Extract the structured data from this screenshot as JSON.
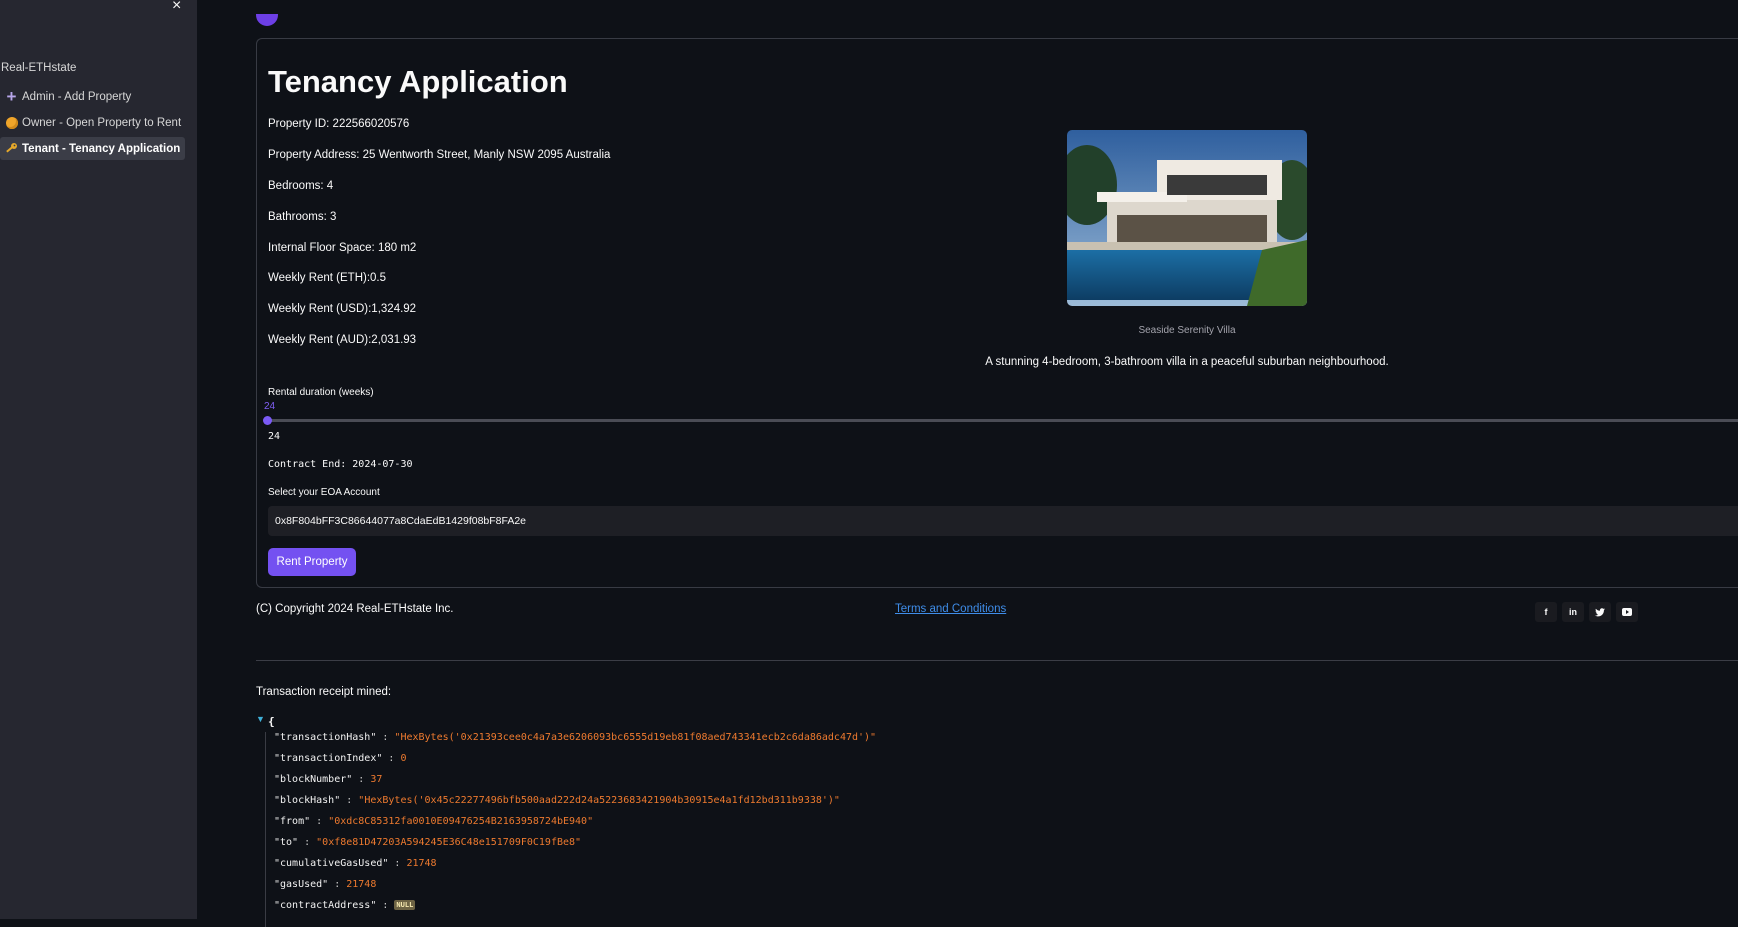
{
  "sidebar": {
    "app_name": "Real-ETHstate",
    "items": [
      {
        "label": "Admin - Add Property",
        "icon": "plus-icon"
      },
      {
        "label": "Owner - Open Property to Rent",
        "icon": "coin-icon"
      },
      {
        "label": "Tenant - Tenancy Application",
        "icon": "key-icon",
        "active": true
      }
    ]
  },
  "page": {
    "title": "Tenancy Application",
    "property": {
      "id": "Property ID: 222566020576",
      "address": "Property Address: 25 Wentworth Street, Manly NSW 2095 Australia",
      "bedrooms": "Bedrooms: 4",
      "bathrooms": "Bathrooms: 3",
      "floor_space": "Internal Floor Space: 180 m2",
      "rent_eth": "Weekly Rent (ETH):0.5",
      "rent_usd": "Weekly Rent (USD):1,324.92",
      "rent_aud": "Weekly Rent (AUD):2,031.93"
    },
    "image": {
      "caption": "Seaside Serenity Villa",
      "description": "A stunning 4-bedroom, 3-bathroom villa in a peaceful suburban neighbourhood."
    },
    "slider": {
      "label": "Rental duration (weeks)",
      "value_label": "24",
      "value": 24,
      "echo": "24"
    },
    "contract_end": "Contract End: 2024-07-30",
    "account": {
      "label": "Select your EOA Account",
      "selected": "0x8F804bFF3C86644077a8CdaEdB1429f08bF8FA2e"
    },
    "rent_button": "Rent Property"
  },
  "footer": {
    "copyright": "(C) Copyright 2024 Real-ETHstate Inc.",
    "terms": "Terms and Conditions",
    "social": [
      "facebook-icon",
      "linkedin-icon",
      "twitter-icon",
      "youtube-icon"
    ]
  },
  "receipt": {
    "label": "Transaction receipt mined:",
    "open_brace": "{",
    "fields": [
      {
        "key": "\"transactionHash\"",
        "value": "\"HexBytes('0x21393cee0c4a7a3e6206093bc6555d19eb81f08aed743341ecb2c6da86adc47d')\""
      },
      {
        "key": "\"transactionIndex\"",
        "value": "0"
      },
      {
        "key": "\"blockNumber\"",
        "value": "37"
      },
      {
        "key": "\"blockHash\"",
        "value": "\"HexBytes('0x45c22277496bfb500aad222d24a5223683421904b30915e4a1fd12bd311b9338')\""
      },
      {
        "key": "\"from\"",
        "value": "\"0xdc8C85312fa0010E09476254B2163958724bE940\""
      },
      {
        "key": "\"to\"",
        "value": "\"0xf8e81D47203A594245E36C48e151709F0C19fBe8\""
      },
      {
        "key": "\"cumulativeGasUsed\"",
        "value": "21748"
      },
      {
        "key": "\"gasUsed\"",
        "value": "21748"
      },
      {
        "key": "\"contractAddress\"",
        "value": "NULL"
      }
    ]
  },
  "colors": {
    "background": "#0e1117",
    "sidebar": "#262730",
    "accent": "#7451f1",
    "link": "#3f8de9",
    "json_value": "#ee7a2f"
  }
}
